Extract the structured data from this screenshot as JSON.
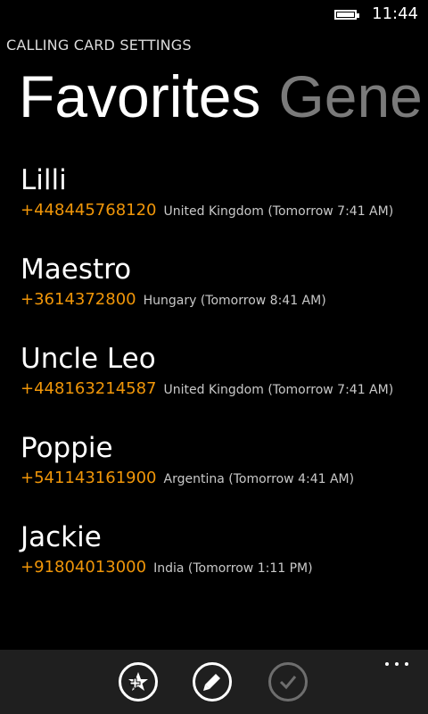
{
  "status": {
    "time": "11:44",
    "battery_icon": "battery-icon"
  },
  "app": {
    "title": "CALLING CARD SETTINGS"
  },
  "pivot": {
    "active": "Favorites",
    "next": "Gene"
  },
  "favorites": [
    {
      "name": "Lilli",
      "number": "+448445768120",
      "info": "United Kingdom (Tomorrow 7:41 AM)"
    },
    {
      "name": "Maestro",
      "number": "+3614372800",
      "info": "Hungary (Tomorrow 8:41 AM)"
    },
    {
      "name": "Uncle Leo",
      "number": "+448163214587",
      "info": "United Kingdom (Tomorrow 7:41 AM)"
    },
    {
      "name": "Poppie",
      "number": "+541143161900",
      "info": "Argentina (Tomorrow 4:41 AM)"
    },
    {
      "name": "Jackie",
      "number": "+91804013000",
      "info": "India (Tomorrow 1:11 PM)"
    }
  ],
  "app_bar": {
    "buttons": [
      {
        "icon": "add-favorite-icon",
        "enabled": true
      },
      {
        "icon": "edit-icon",
        "enabled": true
      },
      {
        "icon": "checkmark-icon",
        "enabled": false
      }
    ],
    "more_icon": "ellipsis-icon"
  },
  "colors": {
    "accent": "#f09609",
    "background": "#000000",
    "app_bar": "#1f1f1f",
    "pivot_inactive": "#7a7a7a"
  }
}
